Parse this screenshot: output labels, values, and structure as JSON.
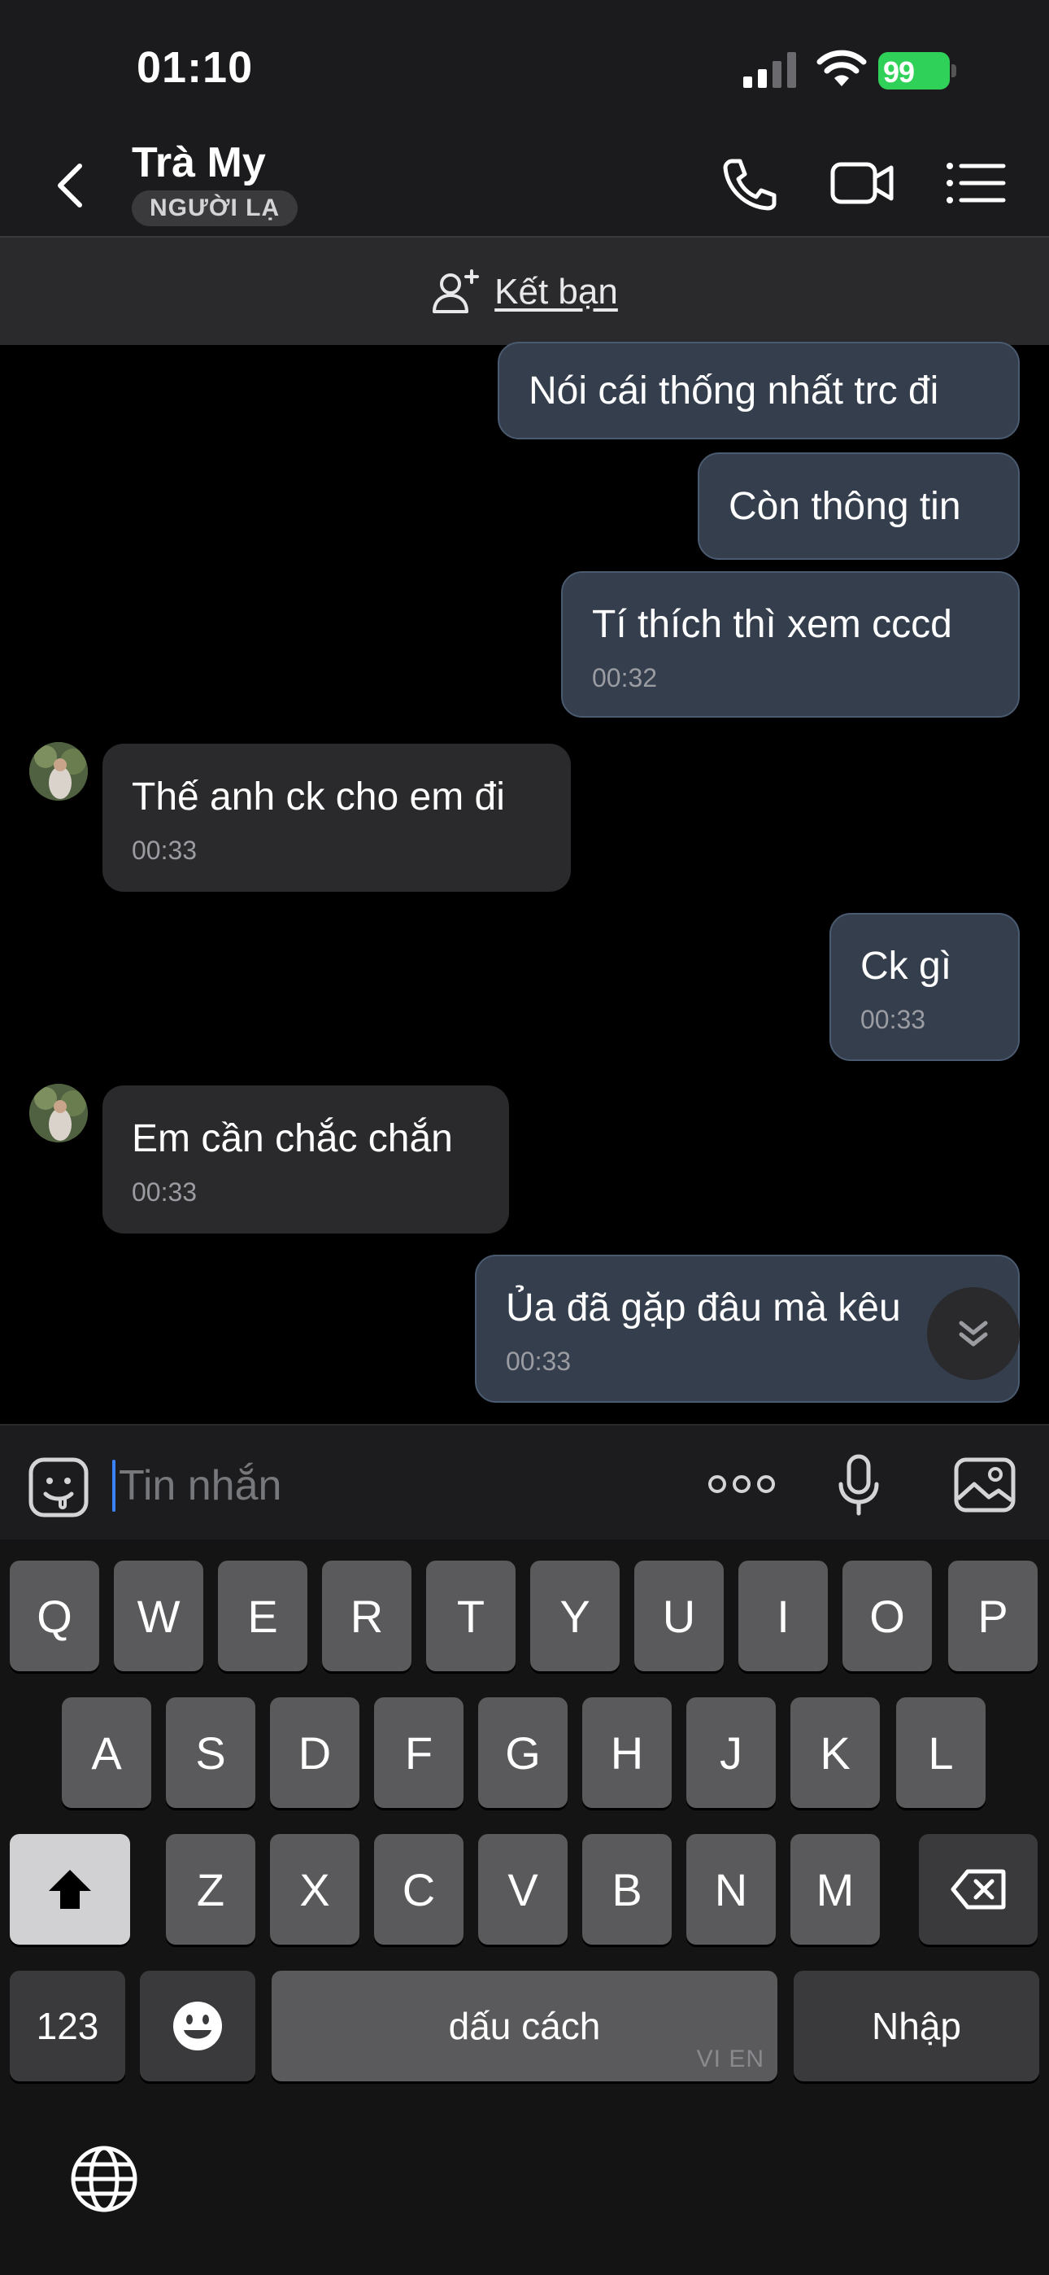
{
  "status_bar": {
    "time": "01:10",
    "battery": "99"
  },
  "header": {
    "name": "Trà My",
    "badge": "NGƯỜI LẠ"
  },
  "friend_bar": {
    "label": "Kết bạn"
  },
  "messages": [
    {
      "text": "Nói cái thống nhất trc đi",
      "time": ""
    },
    {
      "text": "Còn thông tin",
      "time": ""
    },
    {
      "text": "Tí thích thì xem cccd",
      "time": "00:32"
    },
    {
      "text": "Thế anh ck cho em đi",
      "time": "00:33"
    },
    {
      "text": "Ck gì",
      "time": "00:33"
    },
    {
      "text": "Em cần chắc chắn",
      "time": "00:33"
    },
    {
      "text": "Ủa đã gặp đâu mà kêu",
      "time": "00:33"
    }
  ],
  "composer": {
    "placeholder": "Tin nhắn"
  },
  "keyboard": {
    "row1": [
      "Q",
      "W",
      "E",
      "R",
      "T",
      "Y",
      "U",
      "I",
      "O",
      "P"
    ],
    "row2": [
      "A",
      "S",
      "D",
      "F",
      "G",
      "H",
      "J",
      "K",
      "L"
    ],
    "row3": [
      "Z",
      "X",
      "C",
      "V",
      "B",
      "N",
      "M"
    ],
    "numbers": "123",
    "space": "dấu cách",
    "space_lang": "VI EN",
    "enter": "Nhập"
  }
}
